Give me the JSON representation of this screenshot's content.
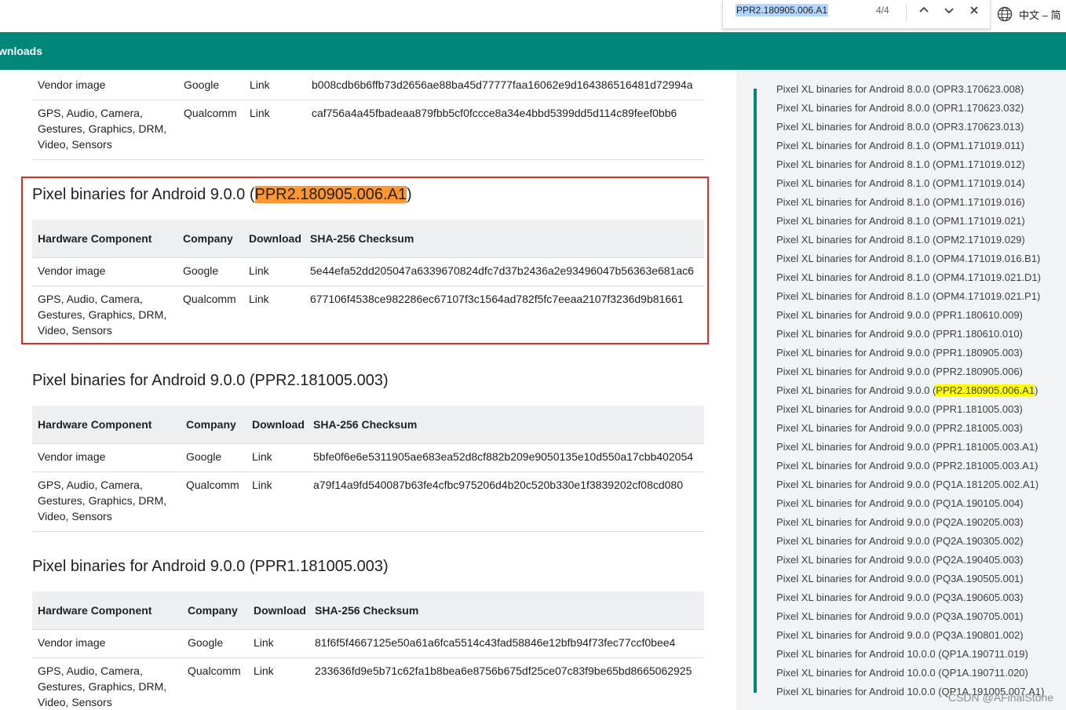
{
  "browser": {
    "find": {
      "query": "PPR2.180905.006.A1",
      "count": "4/4"
    },
    "language_label": "中文 – 简"
  },
  "topbar": {
    "tab_label": "wnloads"
  },
  "headers": {
    "hardware": "Hardware Component",
    "company": "Company",
    "download": "Download",
    "checksum": "SHA-256 Checksum"
  },
  "prev_section": {
    "rows": [
      {
        "hardware": "Vendor image",
        "company": "Google",
        "download": "Link",
        "checksum": "b008cdb6b6ffb73d2656ae88ba45d77777faa16062e9d164386516481d72994a"
      },
      {
        "hardware_lines": [
          "GPS, Audio, Camera,",
          "Gestures, Graphics, DRM,",
          "Video, Sensors"
        ],
        "company": "Qualcomm",
        "download": "Link",
        "checksum": "caf756a4a45fbadeaa879fbb5cf0fccce8a34e4bbd5399dd5d114c89feef0bb6"
      }
    ]
  },
  "sections": [
    {
      "title_prefix": "Pixel binaries for Android 9.0.0 (",
      "title_highlight": "PPR2.180905.006.A1",
      "title_suffix": ")",
      "rows": [
        {
          "hardware": "Vendor image",
          "company": "Google",
          "download": "Link",
          "checksum": "5e44efa52dd205047a6339670824dfc7d37b2436a2e93496047b56363e681ac6"
        },
        {
          "hardware_lines": [
            "GPS, Audio, Camera,",
            "Gestures, Graphics, DRM,",
            "Video, Sensors"
          ],
          "company": "Qualcomm",
          "download": "Link",
          "checksum": "677106f4538ce982286ec67107f3c1564ad782f5fc7eeaa2107f3236d9b81661"
        }
      ]
    },
    {
      "title": "Pixel binaries for Android 9.0.0 (PPR2.181005.003)",
      "rows": [
        {
          "hardware": "Vendor image",
          "company": "Google",
          "download": "Link",
          "checksum": "5bfe0f6e6e5311905ae683ea52d8cf882b209e9050135e10d550a17cbb402054"
        },
        {
          "hardware_lines": [
            "GPS, Audio, Camera,",
            "Gestures, Graphics, DRM,",
            "Video, Sensors"
          ],
          "company": "Qualcomm",
          "download": "Link",
          "checksum": "a79f14a9fd540087b63fe4cfbc975206d4b20c520b330e1f3839202cf08cd080"
        }
      ]
    },
    {
      "title": "Pixel binaries for Android 9.0.0 (PPR1.181005.003)",
      "rows": [
        {
          "hardware": "Vendor image",
          "company": "Google",
          "download": "Link",
          "checksum": "81f6f5f4667125e50a61a6fca5514c43fad58846e12bfb94f73fec77ccf0bee4"
        },
        {
          "hardware_lines": [
            "GPS, Audio, Camera,",
            "Gestures, Graphics, DRM,",
            "Video, Sensors"
          ],
          "company": "Qualcomm",
          "download": "Link",
          "checksum": "233636fd9e5b71c62fa1b8bea6e8756b675df25ce07c83f9be65bd8665062925"
        }
      ]
    }
  ],
  "sidebar": {
    "items": [
      "Pixel XL binaries for Android 8.0.0 (OPR3.170623.008)",
      "Pixel XL binaries for Android 8.0.0 (OPR1.170623.032)",
      "Pixel XL binaries for Android 8.0.0 (OPR3.170623.013)",
      "Pixel XL binaries for Android 8.1.0 (OPM1.171019.011)",
      "Pixel XL binaries for Android 8.1.0 (OPM1.171019.012)",
      "Pixel XL binaries for Android 8.1.0 (OPM1.171019.014)",
      "Pixel XL binaries for Android 8.1.0 (OPM1.171019.016)",
      "Pixel XL binaries for Android 8.1.0 (OPM1.171019.021)",
      "Pixel XL binaries for Android 8.1.0 (OPM2.171019.029)",
      "Pixel XL binaries for Android 8.1.0 (OPM4.171019.016.B1)",
      "Pixel XL binaries for Android 8.1.0 (OPM4.171019.021.D1)",
      "Pixel XL binaries for Android 8.1.0 (OPM4.171019.021.P1)",
      "Pixel XL binaries for Android 9.0.0 (PPR1.180610.009)",
      "Pixel XL binaries for Android 9.0.0 (PPR1.180610.010)",
      "Pixel XL binaries for Android 9.0.0 (PPR1.180905.003)",
      "Pixel XL binaries for Android 9.0.0 (PPR2.180905.006)",
      "Pixel XL binaries for Android 9.0.0 (",
      "Pixel XL binaries for Android 9.0.0 (PPR1.181005.003)",
      "Pixel XL binaries for Android 9.0.0 (PPR2.181005.003)",
      "Pixel XL binaries for Android 9.0.0 (PPR1.181005.003.A1)",
      "Pixel XL binaries for Android 9.0.0 (PPR2.181005.003.A1)",
      "Pixel XL binaries for Android 9.0.0 (PQ1A.181205.002.A1)",
      "Pixel XL binaries for Android 9.0.0 (PQ1A.190105.004)",
      "Pixel XL binaries for Android 9.0.0 (PQ2A.190205.003)",
      "Pixel XL binaries for Android 9.0.0 (PQ2A.190305.002)",
      "Pixel XL binaries for Android 9.0.0 (PQ2A.190405.003)",
      "Pixel XL binaries for Android 9.0.0 (PQ3A.190505.001)",
      "Pixel XL binaries for Android 9.0.0 (PQ3A.190605.003)",
      "Pixel XL binaries for Android 9.0.0 (PQ3A.190705.001)",
      "Pixel XL binaries for Android 9.0.0 (PQ3A.190801.002)",
      "Pixel XL binaries for Android 10.0.0 (QP1A.190711.019)",
      "Pixel XL binaries for Android 10.0.0 (QP1A.190711.020)",
      "Pixel XL binaries for Android 10.0.0 (QP1A.191005.007.A1)"
    ],
    "highlight_item": {
      "prefix": "Pixel XL binaries for Android 9.0.0 (",
      "match": "PPR2.180905.006.A1",
      "suffix": ")"
    }
  },
  "watermark": "CSDN @AFinalStone",
  "colors": {
    "teal": "#01877a",
    "link": "#1a73e8",
    "highlight_current": "#ff9632",
    "highlight_other": "#ffff00",
    "annotation_red": "#d93025"
  }
}
